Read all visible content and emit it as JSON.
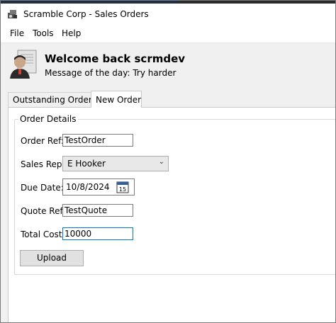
{
  "window": {
    "title": "Scramble Corp - Sales Orders"
  },
  "menu": {
    "items": [
      "File",
      "Tools",
      "Help"
    ]
  },
  "header": {
    "welcome": "Welcome back scrmdev",
    "motd": "Message of the day: Try harder"
  },
  "tabs": [
    {
      "label": "Outstanding Orders",
      "active": false
    },
    {
      "label": "New Order",
      "active": true
    }
  ],
  "form": {
    "group_title": "Order Details",
    "order_ref": {
      "label": "Order Ref:",
      "value": "TestOrder"
    },
    "sales_rep": {
      "label": "Sales Rep:",
      "value": "E Hooker"
    },
    "due_date": {
      "label": "Due Date:",
      "value": "10/8/2024",
      "calendar_day": "15"
    },
    "quote_ref": {
      "label": "Quote Ref:",
      "value": "TestQuote"
    },
    "total_cost": {
      "label": "Total Cost:",
      "value": "10000"
    },
    "upload_label": "Upload"
  },
  "icons": {
    "app": "app-icon",
    "avatar": "user-avatar",
    "dropdown": "chevron-down-icon",
    "calendar": "calendar-icon"
  },
  "colors": {
    "focus_border": "#0078d7",
    "button_bg": "#e1e1e1"
  }
}
